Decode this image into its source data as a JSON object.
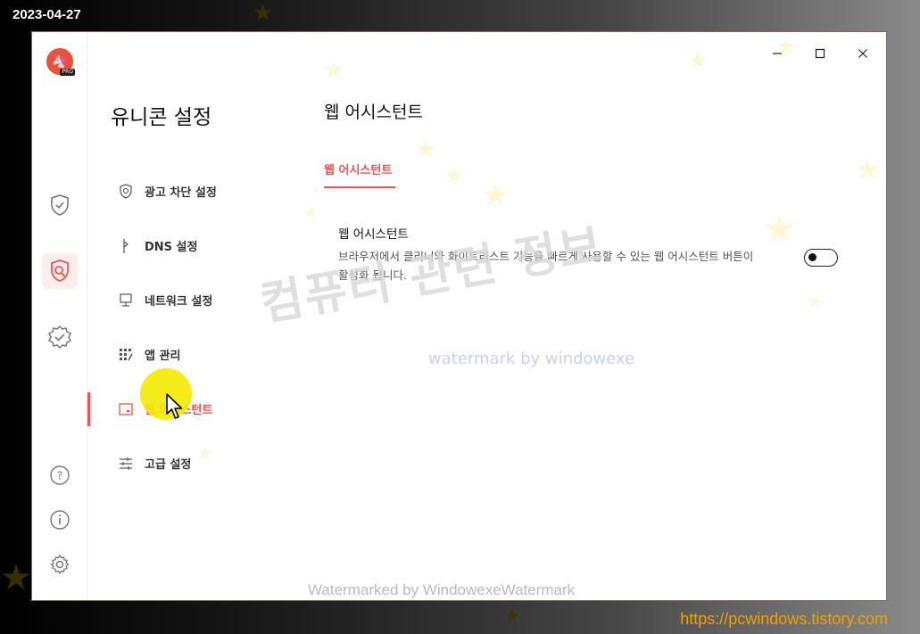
{
  "overlay": {
    "date": "2023-04-27",
    "blog_url": "https://pcwindows.tistory.com",
    "watermark_korean": "컴퓨터 관련 정보",
    "watermark_small": "watermark by windowexe",
    "watermark_bottom": "Watermarked by WindowexeWatermark"
  },
  "window": {
    "controls": [
      "minimize-icon",
      "maximize-icon",
      "close-icon"
    ]
  },
  "rail": {
    "logo_badge": "PRO",
    "icons": [
      "shield-check-icon",
      "shield-wrench-icon",
      "badge-check-icon"
    ],
    "bottom_icons": [
      "help-icon",
      "info-icon",
      "gear-icon"
    ]
  },
  "sidebar": {
    "title": "유니콘 설정",
    "items": [
      {
        "label": "광고 차단 설정",
        "icon": "shield-outline-icon"
      },
      {
        "label": "DNS 설정",
        "icon": "dns-icon"
      },
      {
        "label": "네트워크 설정",
        "icon": "network-icon"
      },
      {
        "label": "앱 관리",
        "icon": "apps-grid-icon"
      },
      {
        "label": "웹 어시스턴트",
        "icon": "browser-icon",
        "active": true
      },
      {
        "label": "고급 설정",
        "icon": "sliders-icon"
      }
    ]
  },
  "main": {
    "title": "웹 어시스턴트",
    "tab_label": "웹 어시스턴트",
    "setting": {
      "name": "웹 어시스턴트",
      "description": "브라우저에서 클리너와 화이트리스트 기능을 빠르게 사용할 수 있는 웹 어시스턴트 버튼이 활성화 됩니다.",
      "enabled": false
    }
  },
  "colors": {
    "accent": "#e85656",
    "window_border": "#2a7fd4",
    "url": "#f0a000"
  }
}
